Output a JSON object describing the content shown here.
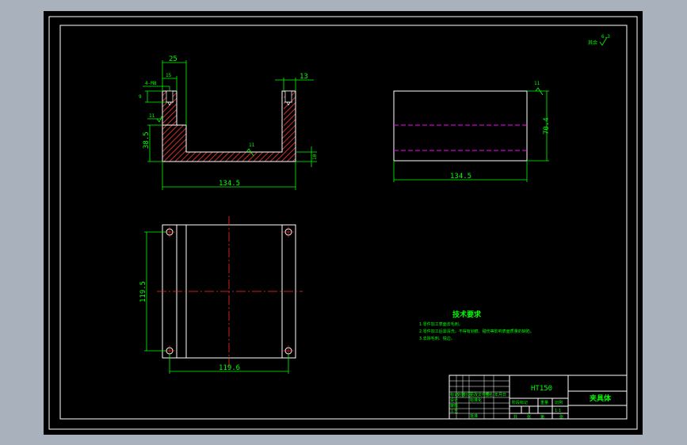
{
  "colors": {
    "background": "#a9b1bd",
    "sheet": "#000000",
    "dimension": "#00ff00",
    "outline": "#ffffff",
    "hatch": "#ff3b3b",
    "centerline": "#ff2a2a",
    "hidden_line": "#ff00ff"
  },
  "roughness": {
    "symbol_label": "其余",
    "value": "6.3"
  },
  "front_view": {
    "dims": {
      "top_width": "25",
      "inner_left": "15",
      "hole_spec": "4-M8",
      "hole_depth": "9",
      "top_right": "13",
      "left_roughness": "11",
      "height": "38.5",
      "floor_roughness": "11",
      "base_thickness": "10",
      "total_width": "134.5"
    }
  },
  "side_view": {
    "dims": {
      "roughness": "11",
      "height": "70.4",
      "width": "134.5"
    }
  },
  "top_view": {
    "dims": {
      "height": "119.5",
      "width": "119.6"
    }
  },
  "tech_requirements": {
    "title": "技术要求",
    "items": [
      "1.零件加工表面去毛刺。",
      "2.零件加工后需清洗，不得有划痕、碰伤等影响表面质量的缺陷。",
      "3.去除毛刺、锐边。"
    ]
  },
  "title_block": {
    "material": "HT150",
    "part_name": "夹具体",
    "left_labels": [
      "标记",
      "处数",
      "分区",
      "更改文件号",
      "签名",
      "年月日"
    ],
    "left_labels_lower": [
      "设计",
      "标准化"
    ],
    "audit_labels": [
      "审核",
      "工艺",
      "批准"
    ],
    "stage_labels": [
      "阶段标记",
      "重量",
      "比例"
    ],
    "sheet_labels": [
      "共",
      "张",
      "第",
      "张"
    ],
    "scale_value": "1:1"
  }
}
